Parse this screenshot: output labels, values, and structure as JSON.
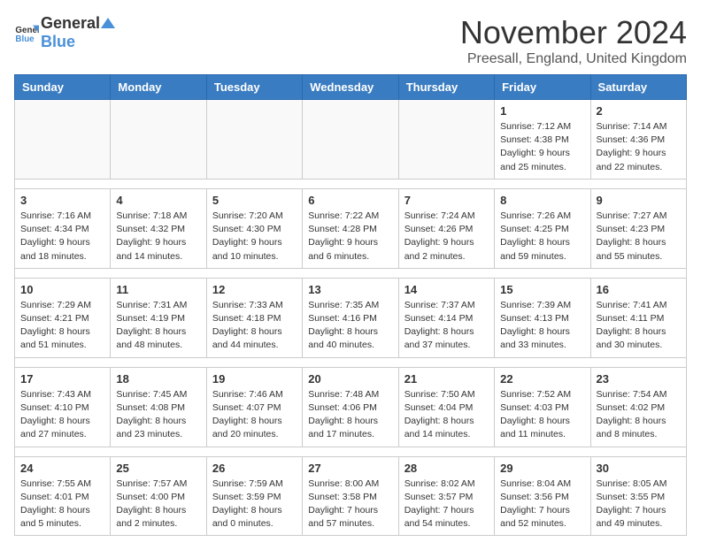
{
  "header": {
    "logo_general": "General",
    "logo_blue": "Blue",
    "title": "November 2024",
    "subtitle": "Preesall, England, United Kingdom"
  },
  "weekdays": [
    "Sunday",
    "Monday",
    "Tuesday",
    "Wednesday",
    "Thursday",
    "Friday",
    "Saturday"
  ],
  "weeks": [
    [
      {
        "day": "",
        "info": ""
      },
      {
        "day": "",
        "info": ""
      },
      {
        "day": "",
        "info": ""
      },
      {
        "day": "",
        "info": ""
      },
      {
        "day": "",
        "info": ""
      },
      {
        "day": "1",
        "info": "Sunrise: 7:12 AM\nSunset: 4:38 PM\nDaylight: 9 hours\nand 25 minutes."
      },
      {
        "day": "2",
        "info": "Sunrise: 7:14 AM\nSunset: 4:36 PM\nDaylight: 9 hours\nand 22 minutes."
      }
    ],
    [
      {
        "day": "3",
        "info": "Sunrise: 7:16 AM\nSunset: 4:34 PM\nDaylight: 9 hours\nand 18 minutes."
      },
      {
        "day": "4",
        "info": "Sunrise: 7:18 AM\nSunset: 4:32 PM\nDaylight: 9 hours\nand 14 minutes."
      },
      {
        "day": "5",
        "info": "Sunrise: 7:20 AM\nSunset: 4:30 PM\nDaylight: 9 hours\nand 10 minutes."
      },
      {
        "day": "6",
        "info": "Sunrise: 7:22 AM\nSunset: 4:28 PM\nDaylight: 9 hours\nand 6 minutes."
      },
      {
        "day": "7",
        "info": "Sunrise: 7:24 AM\nSunset: 4:26 PM\nDaylight: 9 hours\nand 2 minutes."
      },
      {
        "day": "8",
        "info": "Sunrise: 7:26 AM\nSunset: 4:25 PM\nDaylight: 8 hours\nand 59 minutes."
      },
      {
        "day": "9",
        "info": "Sunrise: 7:27 AM\nSunset: 4:23 PM\nDaylight: 8 hours\nand 55 minutes."
      }
    ],
    [
      {
        "day": "10",
        "info": "Sunrise: 7:29 AM\nSunset: 4:21 PM\nDaylight: 8 hours\nand 51 minutes."
      },
      {
        "day": "11",
        "info": "Sunrise: 7:31 AM\nSunset: 4:19 PM\nDaylight: 8 hours\nand 48 minutes."
      },
      {
        "day": "12",
        "info": "Sunrise: 7:33 AM\nSunset: 4:18 PM\nDaylight: 8 hours\nand 44 minutes."
      },
      {
        "day": "13",
        "info": "Sunrise: 7:35 AM\nSunset: 4:16 PM\nDaylight: 8 hours\nand 40 minutes."
      },
      {
        "day": "14",
        "info": "Sunrise: 7:37 AM\nSunset: 4:14 PM\nDaylight: 8 hours\nand 37 minutes."
      },
      {
        "day": "15",
        "info": "Sunrise: 7:39 AM\nSunset: 4:13 PM\nDaylight: 8 hours\nand 33 minutes."
      },
      {
        "day": "16",
        "info": "Sunrise: 7:41 AM\nSunset: 4:11 PM\nDaylight: 8 hours\nand 30 minutes."
      }
    ],
    [
      {
        "day": "17",
        "info": "Sunrise: 7:43 AM\nSunset: 4:10 PM\nDaylight: 8 hours\nand 27 minutes."
      },
      {
        "day": "18",
        "info": "Sunrise: 7:45 AM\nSunset: 4:08 PM\nDaylight: 8 hours\nand 23 minutes."
      },
      {
        "day": "19",
        "info": "Sunrise: 7:46 AM\nSunset: 4:07 PM\nDaylight: 8 hours\nand 20 minutes."
      },
      {
        "day": "20",
        "info": "Sunrise: 7:48 AM\nSunset: 4:06 PM\nDaylight: 8 hours\nand 17 minutes."
      },
      {
        "day": "21",
        "info": "Sunrise: 7:50 AM\nSunset: 4:04 PM\nDaylight: 8 hours\nand 14 minutes."
      },
      {
        "day": "22",
        "info": "Sunrise: 7:52 AM\nSunset: 4:03 PM\nDaylight: 8 hours\nand 11 minutes."
      },
      {
        "day": "23",
        "info": "Sunrise: 7:54 AM\nSunset: 4:02 PM\nDaylight: 8 hours\nand 8 minutes."
      }
    ],
    [
      {
        "day": "24",
        "info": "Sunrise: 7:55 AM\nSunset: 4:01 PM\nDaylight: 8 hours\nand 5 minutes."
      },
      {
        "day": "25",
        "info": "Sunrise: 7:57 AM\nSunset: 4:00 PM\nDaylight: 8 hours\nand 2 minutes."
      },
      {
        "day": "26",
        "info": "Sunrise: 7:59 AM\nSunset: 3:59 PM\nDaylight: 8 hours\nand 0 minutes."
      },
      {
        "day": "27",
        "info": "Sunrise: 8:00 AM\nSunset: 3:58 PM\nDaylight: 7 hours\nand 57 minutes."
      },
      {
        "day": "28",
        "info": "Sunrise: 8:02 AM\nSunset: 3:57 PM\nDaylight: 7 hours\nand 54 minutes."
      },
      {
        "day": "29",
        "info": "Sunrise: 8:04 AM\nSunset: 3:56 PM\nDaylight: 7 hours\nand 52 minutes."
      },
      {
        "day": "30",
        "info": "Sunrise: 8:05 AM\nSunset: 3:55 PM\nDaylight: 7 hours\nand 49 minutes."
      }
    ]
  ]
}
